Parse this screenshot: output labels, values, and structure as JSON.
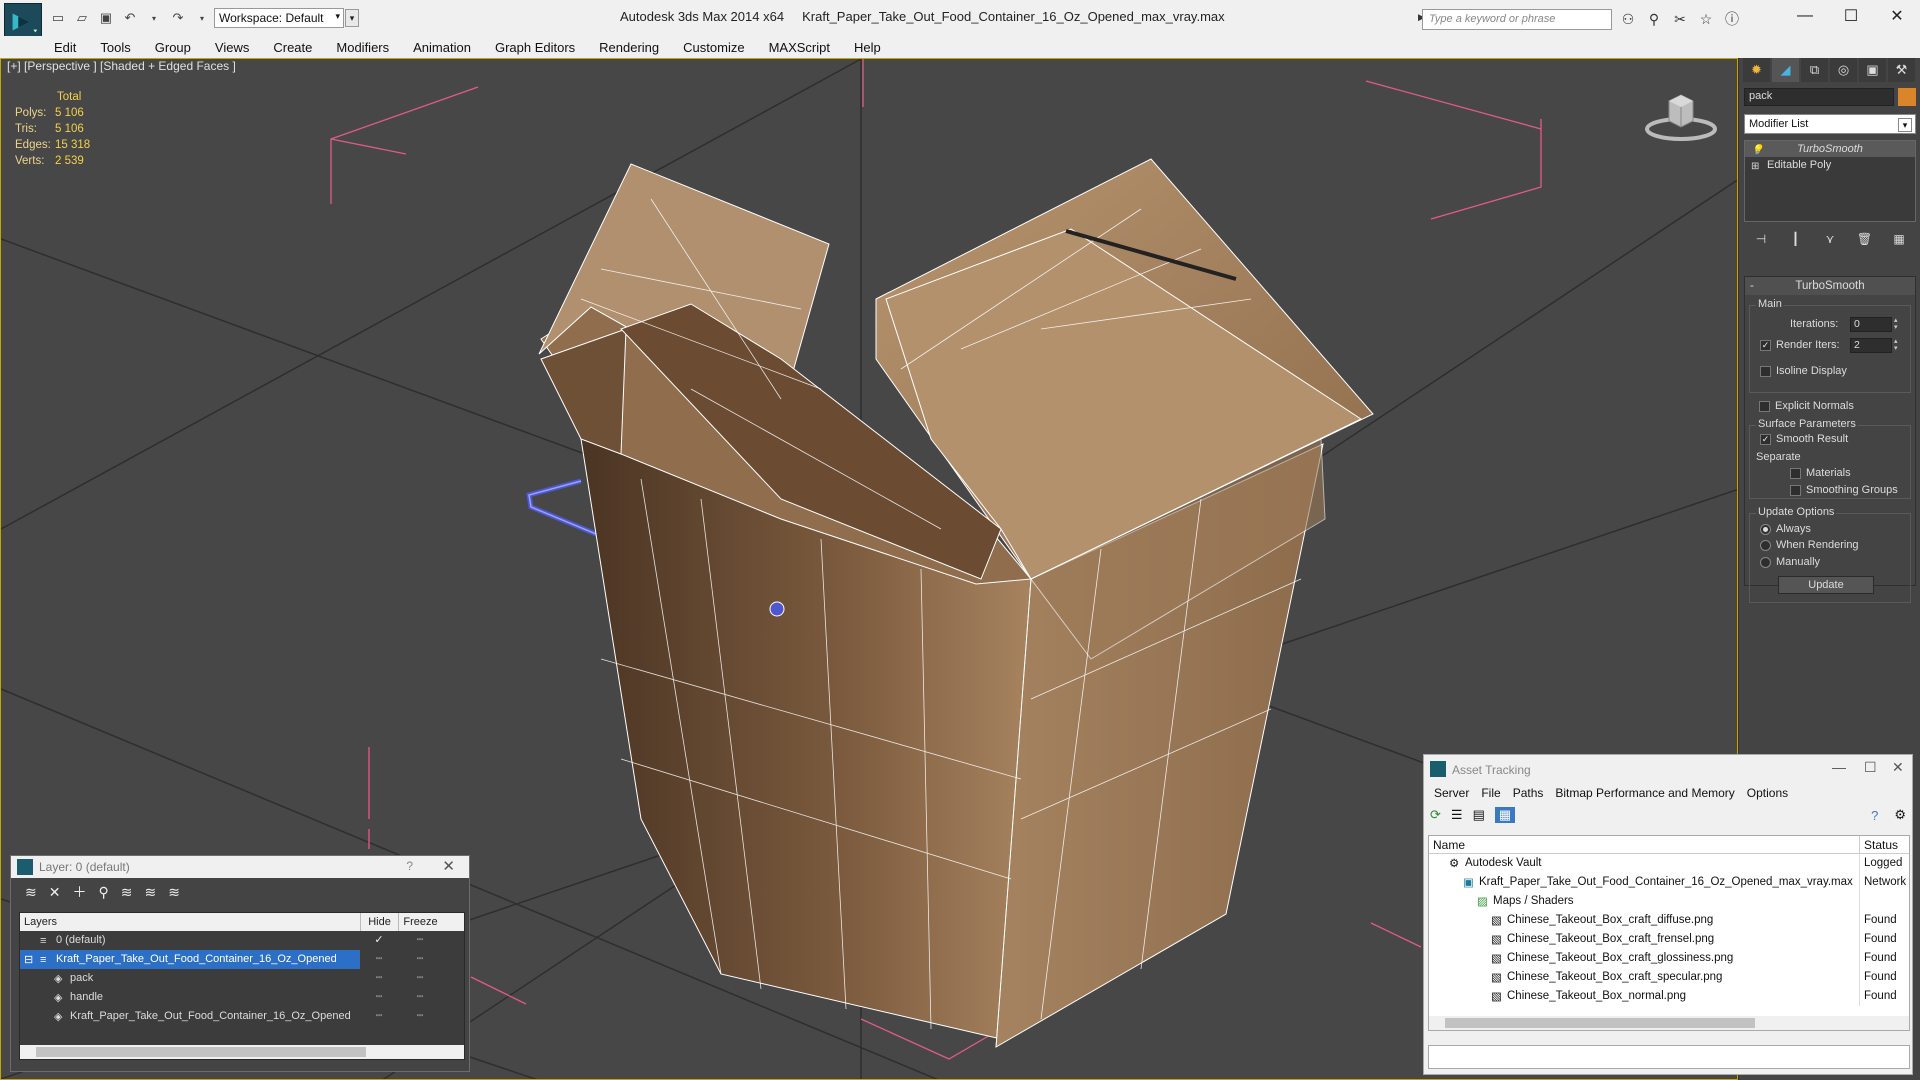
{
  "titlebar": {
    "workspace": "Workspace: Default",
    "app": "Autodesk 3ds Max  2014 x64",
    "file": "Kraft_Paper_Take_Out_Food_Container_16_Oz_Opened_max_vray.max",
    "search_placeholder": "Type a keyword or phrase"
  },
  "menu": [
    "Edit",
    "Tools",
    "Group",
    "Views",
    "Create",
    "Modifiers",
    "Animation",
    "Graph Editors",
    "Rendering",
    "Customize",
    "MAXScript",
    "Help"
  ],
  "viewport": {
    "label": "[+] [Perspective ] [Shaded + Edged Faces ]",
    "stats": {
      "header": "Total",
      "rows": [
        {
          "label": "Polys:",
          "value": "5 106"
        },
        {
          "label": "Tris:",
          "value": "5 106"
        },
        {
          "label": "Edges:",
          "value": "15 318"
        },
        {
          "label": "Verts:",
          "value": "2 539"
        }
      ]
    }
  },
  "command_panel": {
    "object_name": "pack",
    "object_color": "#d8852b",
    "modifier_list": "Modifier List",
    "stack": [
      "TurboSmooth",
      "Editable Poly"
    ],
    "rollout": {
      "title": "TurboSmooth",
      "main": "Main",
      "iterations_label": "Iterations:",
      "iterations": "0",
      "render_iters_label": "Render Iters:",
      "render_iters": "2",
      "isoline": "Isoline Display",
      "explicit": "Explicit Normals",
      "surface": "Surface Parameters",
      "smooth": "Smooth Result",
      "separate": "Separate",
      "materials": "Materials",
      "smoothing_groups": "Smoothing Groups",
      "update_options": "Update Options",
      "always": "Always",
      "when_rendering": "When Rendering",
      "manually": "Manually",
      "update": "Update"
    }
  },
  "layer_window": {
    "title": "Layer: 0 (default)",
    "help": "?",
    "columns": [
      "Layers",
      "Hide",
      "Freeze"
    ],
    "rows": [
      {
        "name": "0 (default)",
        "indent": 1
      },
      {
        "name": "Kraft_Paper_Take_Out_Food_Container_16_Oz_Opened",
        "indent": 1
      },
      {
        "name": "pack",
        "indent": 2
      },
      {
        "name": "handle",
        "indent": 2
      },
      {
        "name": "Kraft_Paper_Take_Out_Food_Container_16_Oz_Opened",
        "indent": 2
      }
    ]
  },
  "asset_window": {
    "title": "Asset Tracking",
    "menu": [
      "Server",
      "File",
      "Paths",
      "Bitmap Performance and Memory",
      "Options"
    ],
    "columns": [
      "Name",
      "Status"
    ],
    "rows": [
      {
        "name": "Autodesk Vault",
        "status": "Logged",
        "indent": 1
      },
      {
        "name": "Kraft_Paper_Take_Out_Food_Container_16_Oz_Opened_max_vray.max",
        "status": "Network",
        "indent": 2
      },
      {
        "name": "Maps / Shaders",
        "status": "",
        "indent": 3
      },
      {
        "name": "Chinese_Takeout_Box_craft_diffuse.png",
        "status": "Found",
        "indent": 4
      },
      {
        "name": "Chinese_Takeout_Box_craft_frensel.png",
        "status": "Found",
        "indent": 4
      },
      {
        "name": "Chinese_Takeout_Box_craft_glossiness.png",
        "status": "Found",
        "indent": 4
      },
      {
        "name": "Chinese_Takeout_Box_craft_specular.png",
        "status": "Found",
        "indent": 4
      },
      {
        "name": "Chinese_Takeout_Box_normal.png",
        "status": "Found",
        "indent": 4
      }
    ]
  }
}
